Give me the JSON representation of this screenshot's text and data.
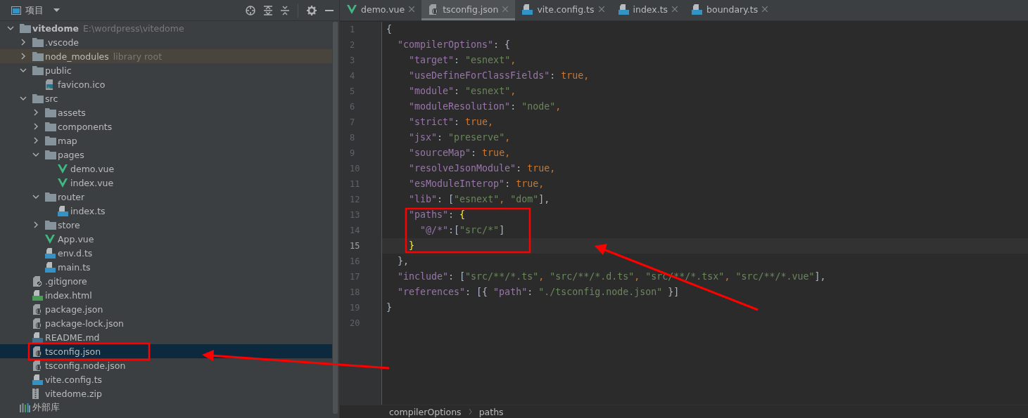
{
  "project_panel": {
    "title": "项目",
    "tree": [
      {
        "name": "vitedome",
        "note": "E:\\wordpress\\vitedome",
        "kind": "folder",
        "expanded": true,
        "selected": false,
        "children": [
          {
            "name": ".vscode",
            "kind": "folder",
            "expanded": false,
            "selected": false
          },
          {
            "name": "node_modules",
            "note": "library root",
            "kind": "library-folder",
            "expanded": false,
            "selected": false
          },
          {
            "name": "public",
            "kind": "folder",
            "expanded": true,
            "selected": false,
            "children": [
              {
                "name": "favicon.ico",
                "kind": "image",
                "selected": false
              }
            ]
          },
          {
            "name": "src",
            "kind": "folder",
            "expanded": true,
            "selected": false,
            "children": [
              {
                "name": "assets",
                "kind": "folder",
                "expanded": false,
                "selected": false
              },
              {
                "name": "components",
                "kind": "folder",
                "expanded": false,
                "selected": false
              },
              {
                "name": "map",
                "kind": "folder",
                "expanded": false,
                "selected": false
              },
              {
                "name": "pages",
                "kind": "folder",
                "expanded": true,
                "selected": false,
                "children": [
                  {
                    "name": "demo.vue",
                    "kind": "vue",
                    "selected": false
                  },
                  {
                    "name": "index.vue",
                    "kind": "vue",
                    "selected": false
                  }
                ]
              },
              {
                "name": "router",
                "kind": "folder",
                "expanded": true,
                "selected": false,
                "children": [
                  {
                    "name": "index.ts",
                    "kind": "ts",
                    "selected": false
                  }
                ]
              },
              {
                "name": "store",
                "kind": "folder",
                "expanded": false,
                "selected": false
              },
              {
                "name": "App.vue",
                "kind": "vue",
                "selected": false
              },
              {
                "name": "env.d.ts",
                "kind": "ts",
                "selected": false
              },
              {
                "name": "main.ts",
                "kind": "ts",
                "selected": false
              }
            ]
          },
          {
            "name": ".gitignore",
            "kind": "ignore",
            "selected": false
          },
          {
            "name": "index.html",
            "kind": "html",
            "selected": false
          },
          {
            "name": "package.json",
            "kind": "json",
            "selected": false
          },
          {
            "name": "package-lock.json",
            "kind": "json",
            "selected": false
          },
          {
            "name": "README.md",
            "kind": "md",
            "selected": false
          },
          {
            "name": "tsconfig.json",
            "kind": "json",
            "selected": true
          },
          {
            "name": "tsconfig.node.json",
            "kind": "json",
            "selected": false
          },
          {
            "name": "vite.config.ts",
            "kind": "ts",
            "selected": false
          },
          {
            "name": "vitedome.zip",
            "kind": "zip",
            "selected": false
          }
        ]
      },
      {
        "name": "外部库",
        "kind": "library",
        "selected": false
      }
    ]
  },
  "editor": {
    "tabs": [
      {
        "label": "demo.vue",
        "kind": "vue",
        "selected": false
      },
      {
        "label": "tsconfig.json",
        "kind": "json",
        "selected": true
      },
      {
        "label": "vite.config.ts",
        "kind": "ts",
        "selected": false
      },
      {
        "label": "index.ts",
        "kind": "ts",
        "selected": false
      },
      {
        "label": "boundary.ts",
        "kind": "ts",
        "selected": false
      }
    ],
    "lines": [
      {
        "number": "1",
        "current": false,
        "tokens": [
          {
            "text": "{",
            "kind": "punct"
          }
        ]
      },
      {
        "number": "2",
        "current": false,
        "tokens": [
          {
            "text": "  \"compilerOptions\"",
            "kind": "key"
          },
          {
            "text": ": {",
            "kind": "punct"
          }
        ]
      },
      {
        "number": "3",
        "current": false,
        "tokens": [
          {
            "text": "    \"target\"",
            "kind": "key"
          },
          {
            "text": ": ",
            "kind": "punct"
          },
          {
            "text": "\"esnext\"",
            "kind": "string"
          },
          {
            "text": ",",
            "kind": "keyword"
          }
        ]
      },
      {
        "number": "4",
        "current": false,
        "tokens": [
          {
            "text": "    \"useDefineForClassFields\"",
            "kind": "key"
          },
          {
            "text": ": ",
            "kind": "punct"
          },
          {
            "text": "true,",
            "kind": "keyword"
          }
        ]
      },
      {
        "number": "5",
        "current": false,
        "tokens": [
          {
            "text": "    \"module\"",
            "kind": "key"
          },
          {
            "text": ": ",
            "kind": "punct"
          },
          {
            "text": "\"esnext\"",
            "kind": "string"
          },
          {
            "text": ",",
            "kind": "keyword"
          }
        ]
      },
      {
        "number": "6",
        "current": false,
        "tokens": [
          {
            "text": "    \"moduleResolution\"",
            "kind": "key"
          },
          {
            "text": ": ",
            "kind": "punct"
          },
          {
            "text": "\"node\"",
            "kind": "string"
          },
          {
            "text": ",",
            "kind": "keyword"
          }
        ]
      },
      {
        "number": "7",
        "current": false,
        "tokens": [
          {
            "text": "    \"strict\"",
            "kind": "key"
          },
          {
            "text": ": ",
            "kind": "punct"
          },
          {
            "text": "true,",
            "kind": "keyword"
          }
        ]
      },
      {
        "number": "8",
        "current": false,
        "tokens": [
          {
            "text": "    \"jsx\"",
            "kind": "key"
          },
          {
            "text": ": ",
            "kind": "punct"
          },
          {
            "text": "\"preserve\"",
            "kind": "string"
          },
          {
            "text": ",",
            "kind": "keyword"
          }
        ]
      },
      {
        "number": "9",
        "current": false,
        "tokens": [
          {
            "text": "    \"sourceMap\"",
            "kind": "key"
          },
          {
            "text": ": ",
            "kind": "punct"
          },
          {
            "text": "true,",
            "kind": "keyword"
          }
        ]
      },
      {
        "number": "10",
        "current": false,
        "tokens": [
          {
            "text": "    \"resolveJsonModule\"",
            "kind": "key"
          },
          {
            "text": ": ",
            "kind": "punct"
          },
          {
            "text": "true,",
            "kind": "keyword"
          }
        ]
      },
      {
        "number": "11",
        "current": false,
        "tokens": [
          {
            "text": "    \"esModuleInterop\"",
            "kind": "key"
          },
          {
            "text": ": ",
            "kind": "punct"
          },
          {
            "text": "true,",
            "kind": "keyword"
          }
        ]
      },
      {
        "number": "12",
        "current": false,
        "tokens": [
          {
            "text": "    \"lib\"",
            "kind": "key"
          },
          {
            "text": ": [",
            "kind": "punct"
          },
          {
            "text": "\"esnext\"",
            "kind": "string"
          },
          {
            "text": ", ",
            "kind": "keyword"
          },
          {
            "text": "\"dom\"",
            "kind": "string"
          },
          {
            "text": "],",
            "kind": "punct"
          }
        ]
      },
      {
        "number": "13",
        "current": false,
        "tokens": [
          {
            "text": "    \"paths\"",
            "kind": "key"
          },
          {
            "text": ": ",
            "kind": "punct"
          },
          {
            "text": "{",
            "kind": "match"
          }
        ]
      },
      {
        "number": "14",
        "current": false,
        "tokens": [
          {
            "text": "      \"@/*\"",
            "kind": "key"
          },
          {
            "text": ":[",
            "kind": "punct"
          },
          {
            "text": "\"src/*\"",
            "kind": "string"
          },
          {
            "text": "]",
            "kind": "punct"
          }
        ]
      },
      {
        "number": "15",
        "current": true,
        "tokens": [
          {
            "text": "    }",
            "kind": "match"
          }
        ]
      },
      {
        "number": "16",
        "current": false,
        "tokens": [
          {
            "text": "  },",
            "kind": "punct"
          }
        ]
      },
      {
        "number": "17",
        "current": false,
        "tokens": [
          {
            "text": "  \"include\"",
            "kind": "key"
          },
          {
            "text": ": [",
            "kind": "punct"
          },
          {
            "text": "\"src/**/*.ts\"",
            "kind": "string"
          },
          {
            "text": ", ",
            "kind": "keyword"
          },
          {
            "text": "\"src/**/*.d.ts\"",
            "kind": "string"
          },
          {
            "text": ", ",
            "kind": "keyword"
          },
          {
            "text": "\"src/**/*.tsx\"",
            "kind": "string"
          },
          {
            "text": ", ",
            "kind": "keyword"
          },
          {
            "text": "\"src/**/*.vue\"",
            "kind": "string"
          },
          {
            "text": "],",
            "kind": "punct"
          }
        ]
      },
      {
        "number": "18",
        "current": false,
        "tokens": [
          {
            "text": "  \"references\"",
            "kind": "key"
          },
          {
            "text": ": [{ ",
            "kind": "punct"
          },
          {
            "text": "\"path\"",
            "kind": "key"
          },
          {
            "text": ": ",
            "kind": "punct"
          },
          {
            "text": "\"./tsconfig.node.json\"",
            "kind": "string"
          },
          {
            "text": " }]",
            "kind": "punct"
          }
        ]
      },
      {
        "number": "19",
        "current": false,
        "tokens": [
          {
            "text": "}",
            "kind": "punct"
          }
        ]
      },
      {
        "number": "20",
        "current": false
      }
    ],
    "breadcrumbs": [
      "compilerOptions",
      "paths"
    ]
  }
}
